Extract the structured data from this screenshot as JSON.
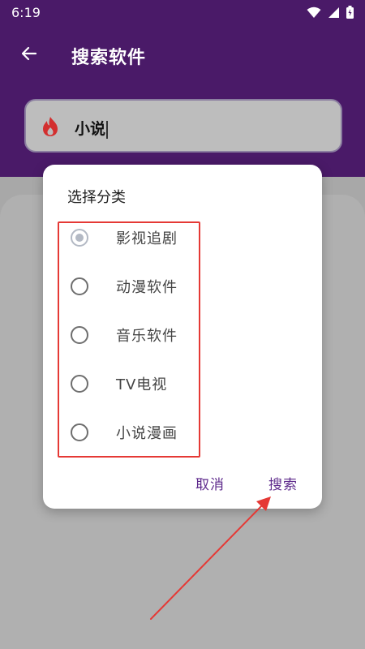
{
  "status_bar": {
    "time": "6:19"
  },
  "app_bar": {
    "title": "搜索软件"
  },
  "search": {
    "value": "小说"
  },
  "dialog": {
    "title": "选择分类",
    "options": [
      {
        "label": "影视追剧",
        "checked": true
      },
      {
        "label": "动漫软件",
        "checked": false
      },
      {
        "label": "音乐软件",
        "checked": false
      },
      {
        "label": "TV电视",
        "checked": false
      },
      {
        "label": "小说漫画",
        "checked": false
      }
    ],
    "cancel_label": "取消",
    "search_label": "搜索"
  },
  "colors": {
    "header": "#4a1a68",
    "accent": "#5e2a8c",
    "highlight_frame": "#e53935",
    "search_icon": "#d32f2f"
  },
  "icons": {
    "back": "arrow-left-icon",
    "search_field": "flame-icon",
    "wifi": "wifi-icon",
    "signal": "signal-icon",
    "battery": "battery-icon"
  }
}
